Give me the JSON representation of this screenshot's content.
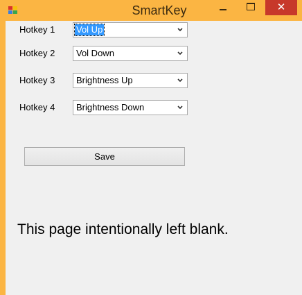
{
  "window": {
    "title": "SmartKey",
    "close_glyph": "✕",
    "icons": [
      "app-icon",
      "minimize-icon",
      "maximize-icon",
      "close-icon"
    ]
  },
  "hotkeys": [
    {
      "label": "Hotkey 1",
      "value": "Vol Up",
      "focused": true
    },
    {
      "label": "Hotkey 2",
      "value": "Vol Down",
      "focused": false
    },
    {
      "label": "Hotkey 3",
      "value": "Brightness Up",
      "focused": false
    },
    {
      "label": "Hotkey 4",
      "value": "Brightness Down",
      "focused": false
    }
  ],
  "save_label": "Save",
  "blank_note": "This page intentionally left blank.",
  "colors": {
    "titlebar": "#fbb543",
    "close_button": "#c7382a",
    "selection": "#3399ff",
    "client_bg": "#f0f0f0"
  }
}
